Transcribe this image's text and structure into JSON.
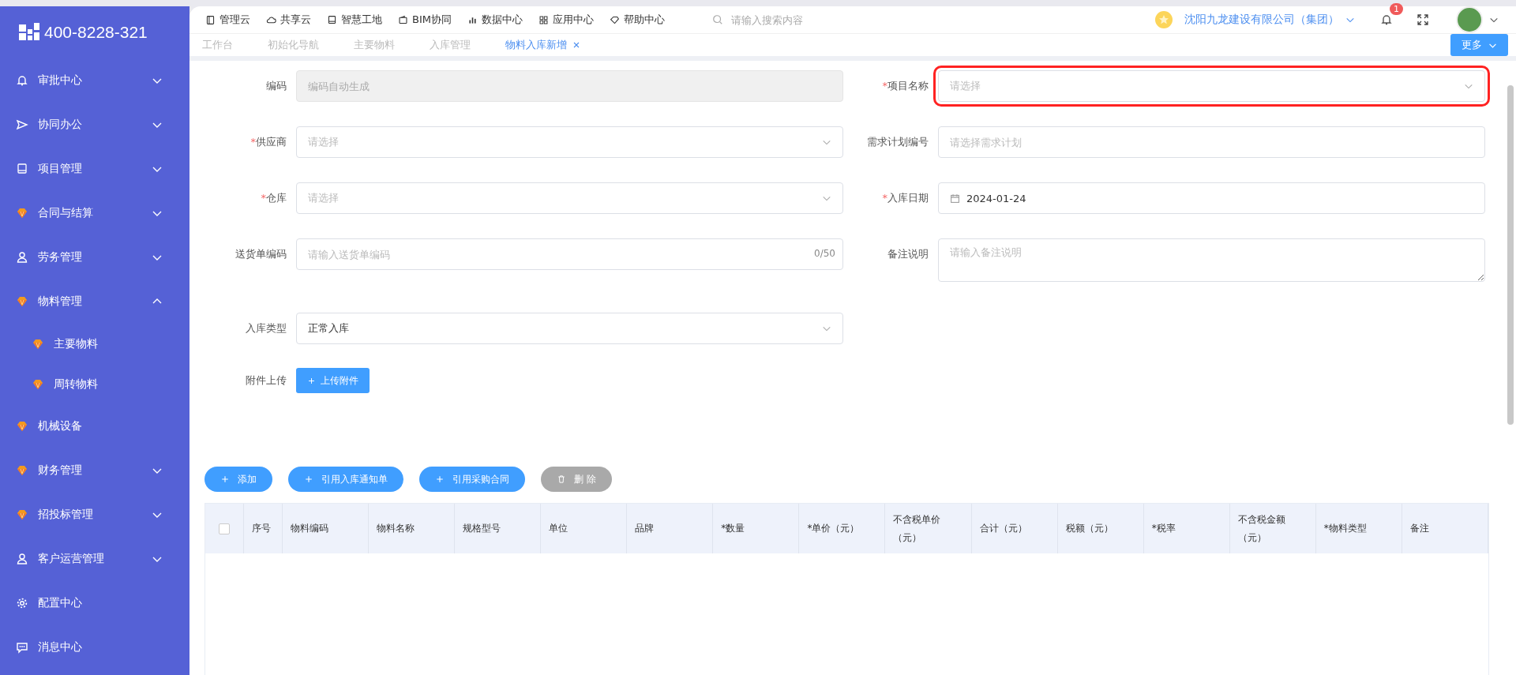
{
  "brand": {
    "phone": "400-8228-321"
  },
  "top_nav": [
    {
      "label": "管理云"
    },
    {
      "label": "共享云"
    },
    {
      "label": "智慧工地"
    },
    {
      "label": "BIM协同"
    },
    {
      "label": "数据中心"
    },
    {
      "label": "应用中心"
    },
    {
      "label": "帮助中心"
    }
  ],
  "search": {
    "placeholder": "请输入搜索内容"
  },
  "company": "沈阳九龙建设有限公司（集团）",
  "notifications": {
    "count": "1"
  },
  "tabs": [
    {
      "label": "工作台",
      "selected": false,
      "closable": false
    },
    {
      "label": "初始化导航",
      "selected": false,
      "closable": false
    },
    {
      "label": "主要物料",
      "selected": false,
      "closable": false
    },
    {
      "label": "入库管理",
      "selected": false,
      "closable": false
    },
    {
      "label": "物料入库新增",
      "selected": true,
      "closable": true
    }
  ],
  "more_button": "更多",
  "sidebar": {
    "items": [
      {
        "label": "审批中心",
        "kind": "group",
        "expanded": false
      },
      {
        "label": "协同办公",
        "kind": "group",
        "expanded": false
      },
      {
        "label": "项目管理",
        "kind": "group",
        "expanded": false
      },
      {
        "label": "合同与结算",
        "kind": "group",
        "expanded": false
      },
      {
        "label": "劳务管理",
        "kind": "group",
        "expanded": false
      },
      {
        "label": "物料管理",
        "kind": "group",
        "expanded": true,
        "children": [
          {
            "label": "主要物料"
          },
          {
            "label": "周转物料"
          }
        ]
      },
      {
        "label": "机械设备",
        "kind": "link"
      },
      {
        "label": "财务管理",
        "kind": "group",
        "expanded": false
      },
      {
        "label": "招投标管理",
        "kind": "group",
        "expanded": false
      },
      {
        "label": "客户运营管理",
        "kind": "group",
        "expanded": false
      },
      {
        "label": "配置中心",
        "kind": "link"
      },
      {
        "label": "消息中心",
        "kind": "link"
      }
    ]
  },
  "form": {
    "required_mark": "*",
    "rows": [
      [
        {
          "label": "编码",
          "kind": "input",
          "required": false,
          "disabled": true,
          "placeholder": "编码自动生成"
        },
        {
          "label": "项目名称",
          "kind": "select",
          "required": true,
          "highlighted": true,
          "placeholder": "请选择"
        }
      ],
      [
        {
          "label": "供应商",
          "kind": "select",
          "required": true,
          "placeholder": "请选择"
        },
        {
          "label": "需求计划编号",
          "kind": "input",
          "required": false,
          "disabled": false,
          "placeholder": "请选择需求计划"
        }
      ],
      [
        {
          "label": "仓库",
          "kind": "select",
          "required": true,
          "placeholder": "请选择"
        },
        {
          "label": "入库日期",
          "kind": "date",
          "required": true,
          "value": "2024-01-24"
        }
      ],
      [
        {
          "label": "送货单编码",
          "kind": "input",
          "required": false,
          "disabled": false,
          "placeholder": "请输入送货单编码",
          "counter": "0/50"
        },
        {
          "label": "备注说明",
          "kind": "textarea",
          "required": false,
          "placeholder": "请输入备注说明"
        }
      ],
      [
        {
          "label": "入库类型",
          "kind": "select",
          "required": false,
          "value": "正常入库"
        }
      ],
      [
        {
          "label": "附件上传",
          "kind": "upload",
          "required": false,
          "button": "上传附件"
        }
      ]
    ]
  },
  "actions": [
    {
      "label": "添加",
      "kind": "add",
      "disabled": false
    },
    {
      "label": "引用入库通知单",
      "kind": "add",
      "disabled": false
    },
    {
      "label": "引用采购合同",
      "kind": "add",
      "disabled": false
    },
    {
      "label": "删 除",
      "kind": "delete",
      "disabled": true
    }
  ],
  "table": {
    "select_all_checked": false,
    "columns": [
      "序号",
      "物料编码",
      "物料名称",
      "规格型号",
      "单位",
      "品牌",
      "*数量",
      "*单价（元）",
      "不含税单价（元）",
      "合计（元）",
      "税额（元）",
      "*税率",
      "不含税金额（元）",
      "*物料类型",
      "备注"
    ]
  }
}
